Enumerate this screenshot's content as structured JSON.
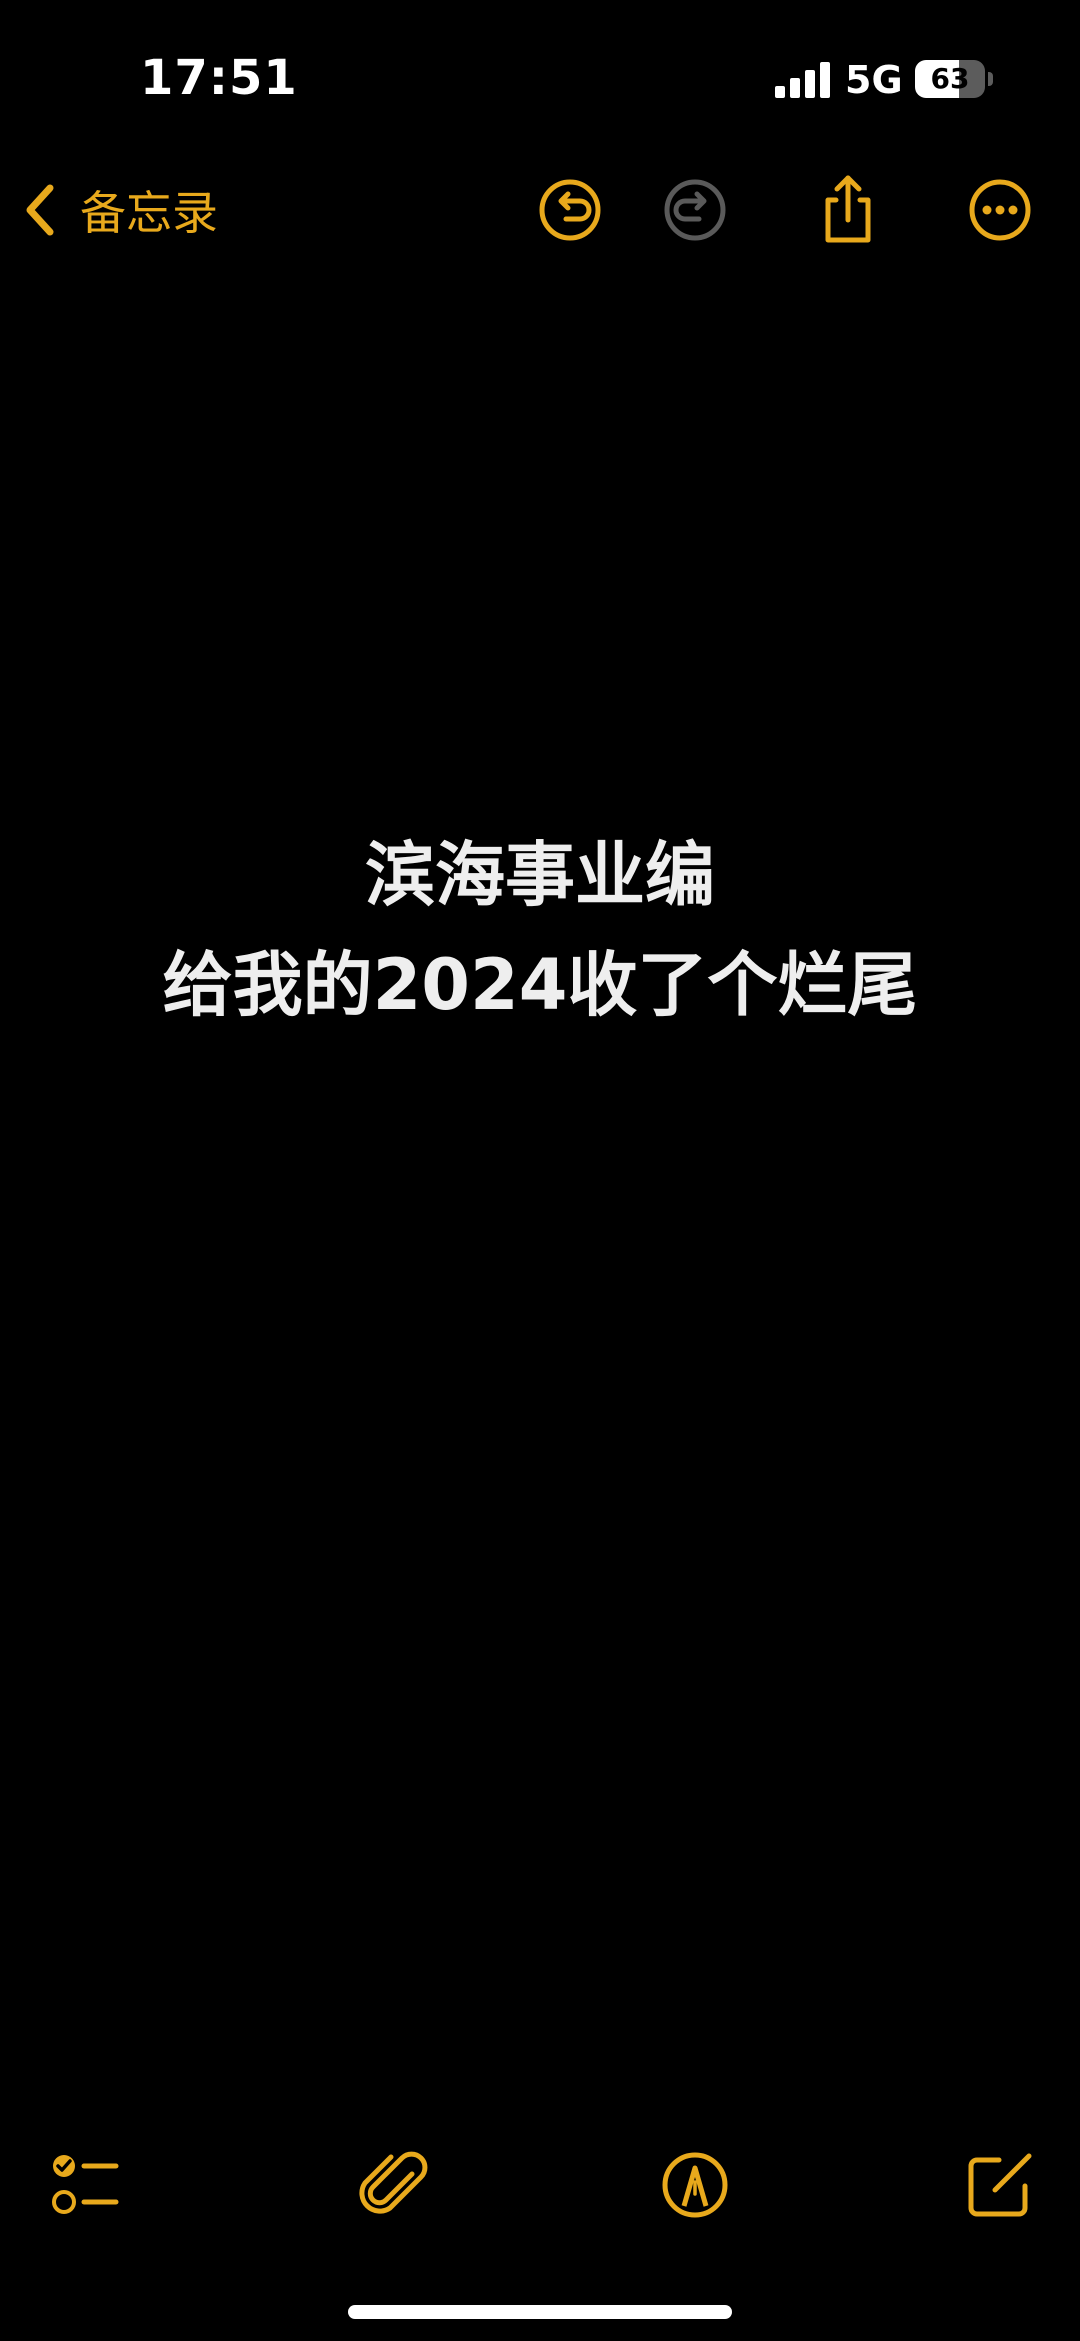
{
  "status_bar": {
    "time": "17:51",
    "network": "5G",
    "battery_level": "63",
    "signal_icon": "cellular-signal-icon"
  },
  "nav": {
    "back_label": "备忘录",
    "icons": {
      "back": "chevron-left-icon",
      "undo": "undo-icon",
      "redo": "redo-icon",
      "share": "share-icon",
      "more": "ellipsis-circle-icon"
    },
    "redo_enabled": false
  },
  "note": {
    "lines": [
      "滨海事业编",
      "给我的2024收了个烂尾"
    ]
  },
  "toolbar": {
    "icons": {
      "checklist": "checklist-icon",
      "attach": "paperclip-icon",
      "markup": "pen-circle-icon",
      "compose": "compose-icon"
    }
  },
  "colors": {
    "accent": "#e8a91c",
    "disabled": "#5a5a5a",
    "background": "#000000",
    "text": "#eeeeee"
  }
}
